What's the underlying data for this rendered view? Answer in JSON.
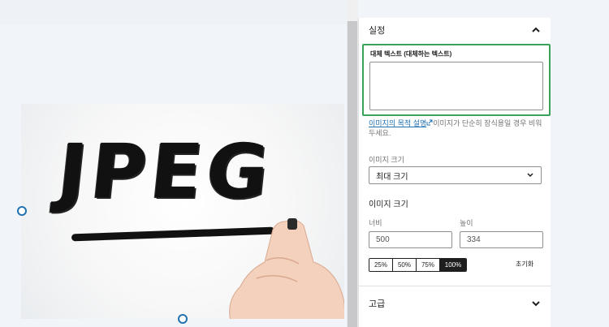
{
  "sidebar": {
    "settings_title": "실정",
    "alt_label": "대체 텍스트 (대체하는 텍스트)",
    "alt_value": "",
    "help_link": "이미지의 목적 설명",
    "help_text": "이미지가 단순히 장식용일 경우 비워두세요.",
    "size_label": "이미지 크기",
    "size_value": "최대 크기",
    "dimensions_title": "이미지 크기",
    "width_label": "너비",
    "width_value": "500",
    "height_label": "높이",
    "height_value": "334",
    "scales": [
      "25%",
      "50%",
      "75%",
      "100%"
    ],
    "active_scale": "100%",
    "reset_label": "초기화",
    "advanced_title": "고급"
  },
  "image": {
    "depicted_text": "JPEG"
  },
  "colors": {
    "focus_border": "#3aa35a",
    "link": "#2271b1",
    "handle": "#2271b1",
    "active_toggle": "#1e1e1e"
  },
  "icons": {
    "collapse": "chevron-up-icon",
    "expand": "chevron-down-icon",
    "external": "external-link-icon"
  }
}
